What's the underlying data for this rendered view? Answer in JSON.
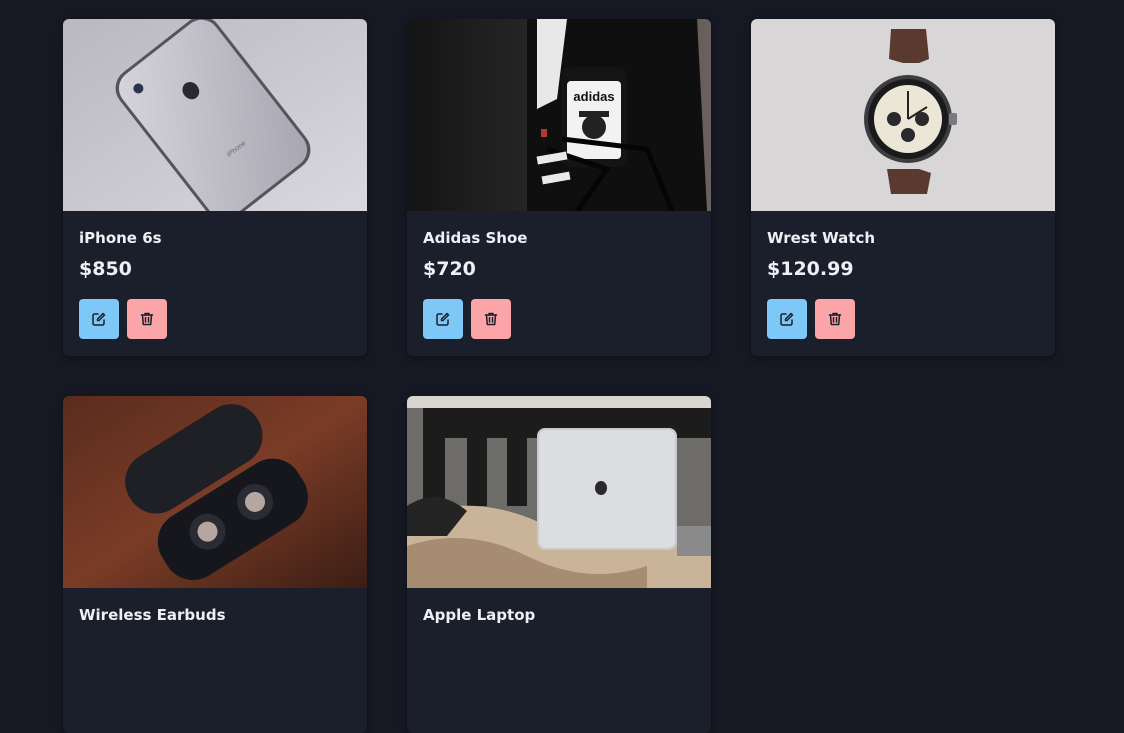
{
  "colors": {
    "background": "#161823",
    "card": "#1b1f2c",
    "text": "#eef0f5",
    "edit_button": "#7ec8f7",
    "delete_button": "#fca5a8"
  },
  "products": [
    {
      "name": "iPhone 6s",
      "price": "$850",
      "image": "iphone-photo"
    },
    {
      "name": "Adidas Shoe",
      "price": "$720",
      "image": "sneaker-photo"
    },
    {
      "name": "Wrest Watch",
      "price": "$120.99",
      "image": "watch-photo"
    },
    {
      "name": "Wireless Earbuds",
      "price": "",
      "image": "earbuds-photo"
    },
    {
      "name": "Apple Laptop",
      "price": "",
      "image": "laptop-photo"
    }
  ],
  "icons": {
    "edit": "pencil-square-icon",
    "delete": "trash-icon"
  }
}
